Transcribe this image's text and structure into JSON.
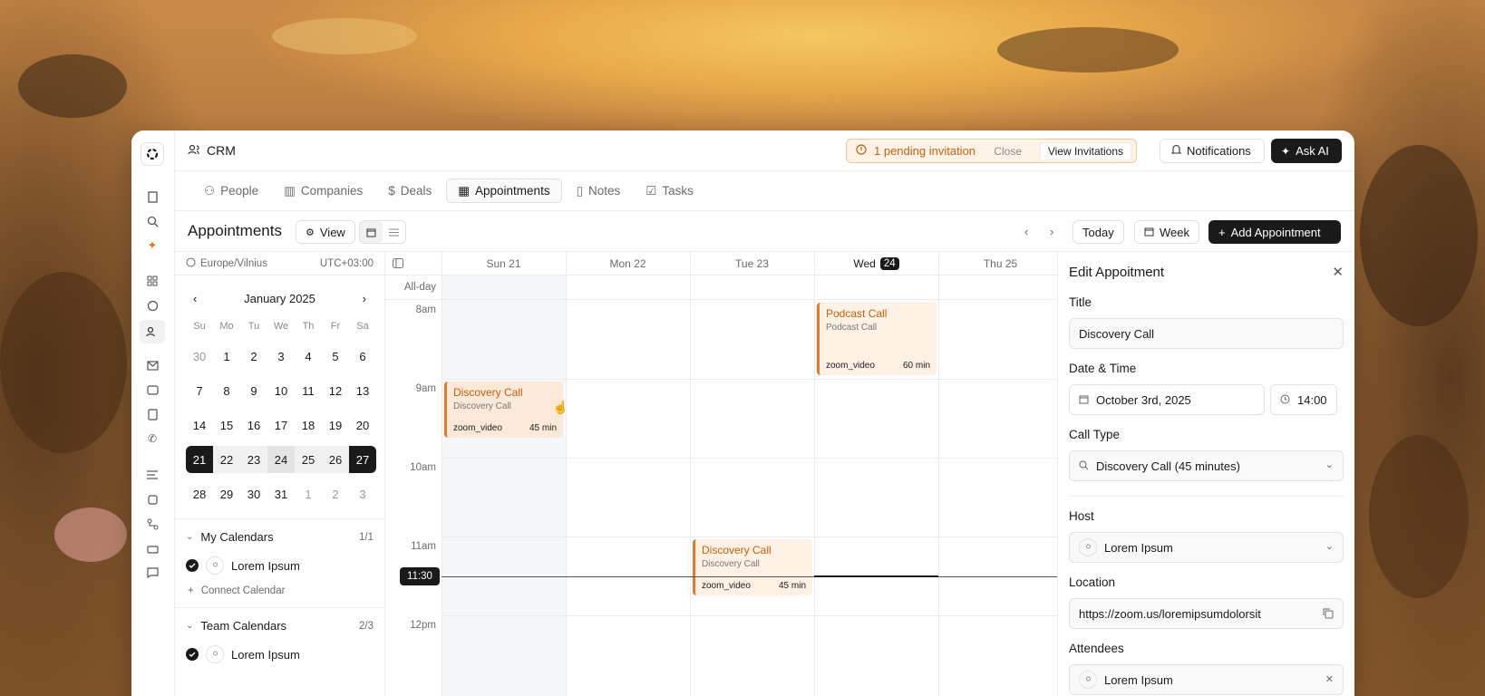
{
  "app": {
    "title": "CRM"
  },
  "invite": {
    "text": "1 pending invitation",
    "close": "Close",
    "view": "View Invitations"
  },
  "header": {
    "notifications": "Notifications",
    "ask_ai": "Ask AI"
  },
  "tabs": [
    {
      "label": "People"
    },
    {
      "label": "Companies"
    },
    {
      "label": "Deals"
    },
    {
      "label": "Appointments"
    },
    {
      "label": "Notes"
    },
    {
      "label": "Tasks"
    }
  ],
  "toolbar": {
    "title": "Appointments",
    "view": "View",
    "today": "Today",
    "week": "Week",
    "add": "Add Appointment"
  },
  "tz": {
    "name": "Europe/Vilnius",
    "offset": "UTC+03:00"
  },
  "minical": {
    "month": "January 2025",
    "dow": [
      "Su",
      "Mo",
      "Tu",
      "We",
      "Th",
      "Fr",
      "Sa"
    ],
    "days": [
      "30",
      "1",
      "2",
      "3",
      "4",
      "5",
      "6",
      "7",
      "8",
      "9",
      "10",
      "11",
      "12",
      "13",
      "14",
      "15",
      "16",
      "17",
      "18",
      "19",
      "20",
      "21",
      "22",
      "23",
      "24",
      "25",
      "26",
      "27",
      "28",
      "29",
      "30",
      "31",
      "1",
      "2",
      "3"
    ]
  },
  "my_calendars": {
    "label": "My Calendars",
    "count": "1/1",
    "items": [
      {
        "name": "Lorem Ipsum"
      }
    ],
    "connect": "Connect Calendar"
  },
  "team_calendars": {
    "label": "Team Calendars",
    "count": "2/3",
    "items": [
      {
        "name": "Lorem Ipsum"
      }
    ]
  },
  "week": {
    "columns": [
      "Sun 21",
      "Mon 22",
      "Tue 23",
      "Wed",
      "Thu 25"
    ],
    "today_num": "24",
    "allday": "All-day",
    "times": [
      "8am",
      "9am",
      "10am",
      "11am",
      "12pm"
    ],
    "now": "11:30"
  },
  "events": [
    {
      "title": "Podcast Call",
      "sub": "Podcast Call",
      "loc": "zoom_video",
      "dur": "60 min"
    },
    {
      "title": "Discovery Call",
      "sub": "Discovery Call",
      "loc": "zoom_video",
      "dur": "45 min"
    },
    {
      "title": "Discovery Call",
      "sub": "Discovery Call",
      "loc": "zoom_video",
      "dur": "45 min"
    }
  ],
  "edit": {
    "heading": "Edit Appoitment",
    "title_label": "Title",
    "title_value": "Discovery Call",
    "dt_label": "Date & Time",
    "date": "October 3rd, 2025",
    "time": "14:00",
    "type_label": "Call Type",
    "type_value": "Discovery Call (45 minutes)",
    "host_label": "Host",
    "host_value": "Lorem Ipsum",
    "loc_label": "Location",
    "loc_value": "https://zoom.us/loremipsumdolorsit",
    "att_label": "Attendees",
    "att_value": "Lorem Ipsum"
  }
}
